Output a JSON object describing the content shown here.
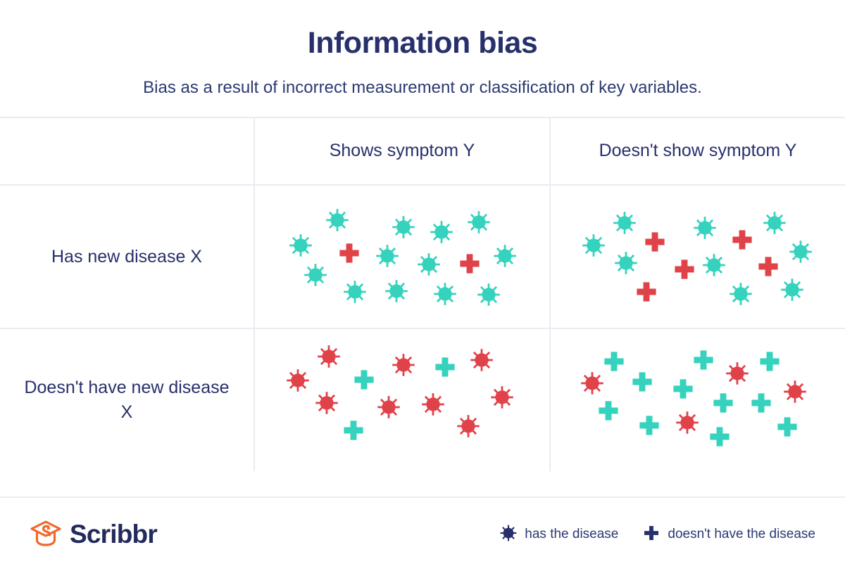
{
  "header": {
    "title": "Information bias",
    "subtitle": "Bias as a result of incorrect measurement or classification of key variables."
  },
  "colors": {
    "navy": "#27306b",
    "teal": "#35d2bd",
    "red": "#e04249",
    "orange": "#f2682a",
    "border": "#ebebf3",
    "background": "#ffffff"
  },
  "table": {
    "corner_label": "",
    "column_headers": [
      "Shows symptom Y",
      "Doesn't show symptom Y"
    ],
    "row_headers": [
      "Has new disease X",
      "Doesn't have new disease X"
    ]
  },
  "chart_data": {
    "type": "scatter",
    "title": "Information bias",
    "subtitle": "Bias as a result of incorrect measurement or classification of key variables.",
    "description": "2x2 contingency table of disease status vs symptom status, each cell filled with scattered glyphs. Virus glyph = has the disease, plus glyph = doesn't have the disease. Teal glyphs indicate correct classification within the cell; red glyphs indicate misclassified cases.",
    "legend": [
      {
        "icon": "virus-icon",
        "label": "has the disease"
      },
      {
        "icon": "plus-icon",
        "label": "doesn't have the disease"
      }
    ],
    "cells": [
      {
        "row": "Has new disease X",
        "column": "Shows symptom Y",
        "counts": {
          "virus_teal": 12,
          "plus_red": 2,
          "virus_red": 0,
          "plus_teal": 0
        },
        "total": 14,
        "glyphs": [
          {
            "shape": "virus",
            "color": "teal",
            "x": 15.5,
            "y": 42.0
          },
          {
            "shape": "virus",
            "color": "teal",
            "x": 28.0,
            "y": 24.5
          },
          {
            "shape": "virus",
            "color": "teal",
            "x": 20.5,
            "y": 63.0
          },
          {
            "shape": "plus",
            "color": "red",
            "x": 32.0,
            "y": 47.5
          },
          {
            "shape": "virus",
            "color": "teal",
            "x": 34.0,
            "y": 75.0
          },
          {
            "shape": "virus",
            "color": "teal",
            "x": 45.0,
            "y": 49.5
          },
          {
            "shape": "virus",
            "color": "teal",
            "x": 50.5,
            "y": 29.0
          },
          {
            "shape": "virus",
            "color": "teal",
            "x": 48.0,
            "y": 74.5
          },
          {
            "shape": "virus",
            "color": "teal",
            "x": 59.0,
            "y": 55.5
          },
          {
            "shape": "virus",
            "color": "teal",
            "x": 63.5,
            "y": 32.5
          },
          {
            "shape": "virus",
            "color": "teal",
            "x": 64.5,
            "y": 76.5
          },
          {
            "shape": "plus",
            "color": "red",
            "x": 73.0,
            "y": 55.0
          },
          {
            "shape": "virus",
            "color": "teal",
            "x": 76.0,
            "y": 26.0
          },
          {
            "shape": "virus",
            "color": "teal",
            "x": 79.5,
            "y": 77.0
          },
          {
            "shape": "virus",
            "color": "teal",
            "x": 85.0,
            "y": 49.5
          }
        ]
      },
      {
        "row": "Has new disease X",
        "column": "Doesn't show symptom Y",
        "counts": {
          "virus_teal": 9,
          "plus_red": 5,
          "virus_red": 0,
          "plus_teal": 0
        },
        "total": 14,
        "glyphs": [
          {
            "shape": "virus",
            "color": "teal",
            "x": 14.5,
            "y": 42.0
          },
          {
            "shape": "virus",
            "color": "teal",
            "x": 25.0,
            "y": 26.5
          },
          {
            "shape": "virus",
            "color": "teal",
            "x": 25.5,
            "y": 54.5
          },
          {
            "shape": "plus",
            "color": "red",
            "x": 35.5,
            "y": 39.5
          },
          {
            "shape": "plus",
            "color": "red",
            "x": 32.5,
            "y": 75.0
          },
          {
            "shape": "plus",
            "color": "red",
            "x": 45.5,
            "y": 59.0
          },
          {
            "shape": "virus",
            "color": "teal",
            "x": 52.5,
            "y": 29.5
          },
          {
            "shape": "virus",
            "color": "teal",
            "x": 55.5,
            "y": 56.0
          },
          {
            "shape": "virus",
            "color": "teal",
            "x": 64.5,
            "y": 76.5
          },
          {
            "shape": "plus",
            "color": "red",
            "x": 65.0,
            "y": 38.0
          },
          {
            "shape": "plus",
            "color": "red",
            "x": 74.0,
            "y": 57.0
          },
          {
            "shape": "virus",
            "color": "teal",
            "x": 76.0,
            "y": 26.5
          },
          {
            "shape": "virus",
            "color": "teal",
            "x": 85.0,
            "y": 46.5
          },
          {
            "shape": "virus",
            "color": "teal",
            "x": 82.0,
            "y": 73.5
          }
        ]
      },
      {
        "row": "Doesn't have new disease X",
        "column": "Shows symptom Y",
        "counts": {
          "virus_red": 9,
          "plus_teal": 3,
          "virus_teal": 0,
          "plus_red": 0
        },
        "total": 12,
        "glyphs": [
          {
            "shape": "virus",
            "color": "red",
            "x": 14.5,
            "y": 36.0
          },
          {
            "shape": "virus",
            "color": "red",
            "x": 25.0,
            "y": 19.5
          },
          {
            "shape": "virus",
            "color": "red",
            "x": 24.5,
            "y": 52.0
          },
          {
            "shape": "plus",
            "color": "teal",
            "x": 37.0,
            "y": 35.5
          },
          {
            "shape": "plus",
            "color": "teal",
            "x": 33.5,
            "y": 71.5
          },
          {
            "shape": "virus",
            "color": "red",
            "x": 45.5,
            "y": 55.0
          },
          {
            "shape": "virus",
            "color": "red",
            "x": 50.5,
            "y": 25.5
          },
          {
            "shape": "plus",
            "color": "teal",
            "x": 64.5,
            "y": 27.0
          },
          {
            "shape": "virus",
            "color": "red",
            "x": 60.5,
            "y": 53.0
          },
          {
            "shape": "virus",
            "color": "red",
            "x": 72.5,
            "y": 68.5
          },
          {
            "shape": "virus",
            "color": "red",
            "x": 77.0,
            "y": 22.0
          },
          {
            "shape": "virus",
            "color": "red",
            "x": 84.0,
            "y": 48.0
          }
        ]
      },
      {
        "row": "Doesn't have new disease X",
        "column": "Doesn't show symptom Y",
        "counts": {
          "plus_teal": 12,
          "virus_red": 4,
          "virus_teal": 0,
          "plus_red": 0
        },
        "total": 16,
        "glyphs": [
          {
            "shape": "virus",
            "color": "red",
            "x": 14.0,
            "y": 38.0
          },
          {
            "shape": "plus",
            "color": "teal",
            "x": 21.5,
            "y": 23.0
          },
          {
            "shape": "plus",
            "color": "teal",
            "x": 19.5,
            "y": 57.5
          },
          {
            "shape": "plus",
            "color": "teal",
            "x": 31.0,
            "y": 37.0
          },
          {
            "shape": "plus",
            "color": "teal",
            "x": 33.5,
            "y": 68.0
          },
          {
            "shape": "plus",
            "color": "teal",
            "x": 45.0,
            "y": 42.0
          },
          {
            "shape": "virus",
            "color": "red",
            "x": 46.5,
            "y": 66.0
          },
          {
            "shape": "plus",
            "color": "teal",
            "x": 52.0,
            "y": 22.0
          },
          {
            "shape": "plus",
            "color": "teal",
            "x": 58.5,
            "y": 52.0
          },
          {
            "shape": "plus",
            "color": "teal",
            "x": 57.5,
            "y": 76.0
          },
          {
            "shape": "virus",
            "color": "red",
            "x": 63.5,
            "y": 31.0
          },
          {
            "shape": "plus",
            "color": "teal",
            "x": 71.5,
            "y": 52.0
          },
          {
            "shape": "plus",
            "color": "teal",
            "x": 74.5,
            "y": 23.0
          },
          {
            "shape": "virus",
            "color": "red",
            "x": 83.0,
            "y": 44.0
          },
          {
            "shape": "plus",
            "color": "teal",
            "x": 80.5,
            "y": 69.0
          }
        ]
      }
    ]
  },
  "footer": {
    "logo_text": "Scribbr",
    "legend": [
      {
        "icon": "virus-icon",
        "label": "has the disease"
      },
      {
        "icon": "plus-icon",
        "label": "doesn't have the disease"
      }
    ]
  }
}
